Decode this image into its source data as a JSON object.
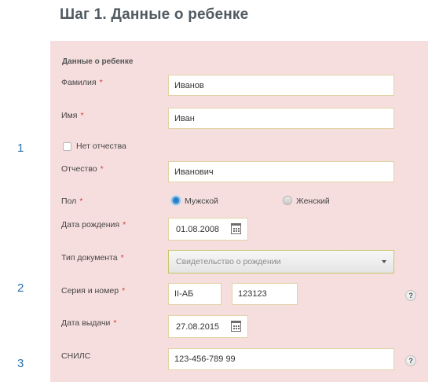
{
  "page": {
    "title": "Шаг 1. Данные о ребенке"
  },
  "section": {
    "heading": "Данные о ребенке"
  },
  "markers": [
    "1",
    "2",
    "3"
  ],
  "fields": {
    "surname": {
      "label": "Фамилия",
      "required": "*",
      "value": "Иванов"
    },
    "name": {
      "label": "Имя",
      "required": "*",
      "value": "Иван"
    },
    "no_patronymic": {
      "label": "Нет отчества",
      "checked": false
    },
    "patronymic": {
      "label": "Отчество",
      "required": "*",
      "value": "Иванович"
    },
    "gender": {
      "label": "Пол",
      "required": "*",
      "options": [
        "Мужской",
        "Женский"
      ],
      "selected": "Мужской"
    },
    "birth_date": {
      "label": "Дата рождения",
      "required": "*",
      "value": "01.08.2008"
    },
    "doc_type": {
      "label": "Тип документа",
      "required": "*",
      "value": "Свидетельство о рождении"
    },
    "series_number": {
      "label": "Серия и номер",
      "required": "*",
      "series": "II-АБ",
      "number": "123123"
    },
    "issue_date": {
      "label": "Дата выдачи",
      "required": "*",
      "value": "27.08.2015"
    },
    "snils": {
      "label": "СНИЛС",
      "value": "123-456-789 99"
    }
  },
  "help": {
    "symbol": "?"
  },
  "colors": {
    "panel_bg": "#f7dede",
    "field_border": "#e1d3a6",
    "required": "#d23b3b",
    "marker": "#2b70ae",
    "radio_selected": "#2e7fc4"
  }
}
